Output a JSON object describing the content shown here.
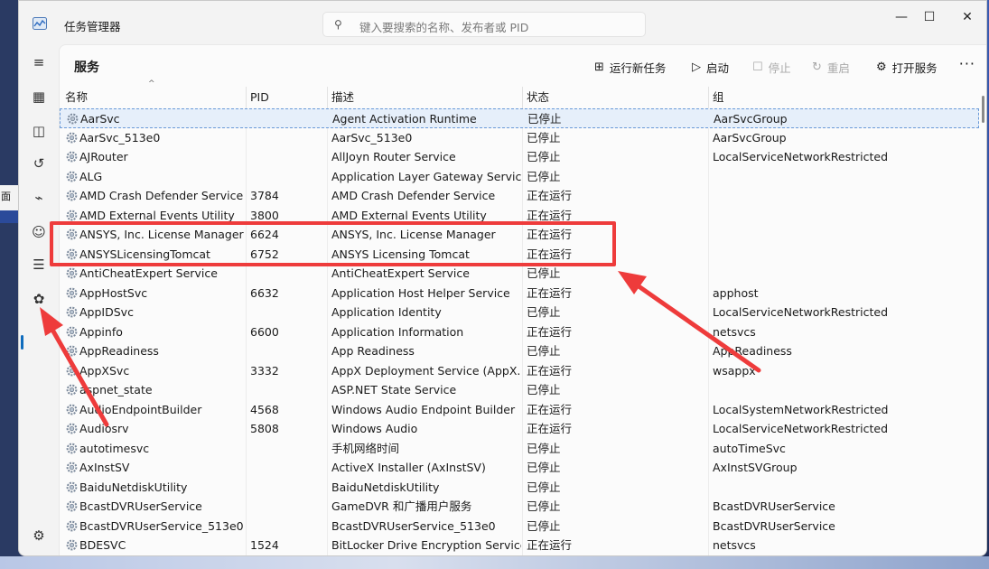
{
  "app": {
    "title": "任务管理器",
    "search_placeholder": "键入要搜索的名称、发布者或 PID",
    "minimize": "—",
    "maximize": "☐",
    "close": "✕"
  },
  "background": {
    "taskbar_fragment": "面"
  },
  "nav": {
    "items": [
      {
        "name": "menu-icon",
        "glyph": "≡"
      },
      {
        "name": "processes-icon",
        "glyph": "▦"
      },
      {
        "name": "performance-icon",
        "glyph": "◫"
      },
      {
        "name": "app-history-icon",
        "glyph": "↺"
      },
      {
        "name": "startup-icon",
        "glyph": "⌁"
      },
      {
        "name": "users-icon",
        "glyph": "☺"
      },
      {
        "name": "details-icon",
        "glyph": "☰"
      },
      {
        "name": "services-icon",
        "glyph": "✿"
      },
      {
        "name": "settings-icon",
        "glyph": "⚙"
      }
    ]
  },
  "page": {
    "title": "服务"
  },
  "toolbar": {
    "run_new_task": "运行新任务",
    "start": "启动",
    "stop": "停止",
    "restart": "重启",
    "open_services": "打开服务",
    "more": "···"
  },
  "table": {
    "columns": [
      "名称",
      "PID",
      "描述",
      "状态",
      "组"
    ],
    "rows": [
      [
        "AarSvc",
        "",
        "Agent Activation Runtime",
        "已停止",
        "AarSvcGroup"
      ],
      [
        "AarSvc_513e0",
        "",
        "AarSvc_513e0",
        "已停止",
        "AarSvcGroup"
      ],
      [
        "AJRouter",
        "",
        "AllJoyn Router Service",
        "已停止",
        "LocalServiceNetworkRestricted"
      ],
      [
        "ALG",
        "",
        "Application Layer Gateway Service",
        "已停止",
        ""
      ],
      [
        "AMD Crash Defender Service",
        "3784",
        "AMD Crash Defender Service",
        "正在运行",
        ""
      ],
      [
        "AMD External Events Utility",
        "3800",
        "AMD External Events Utility",
        "正在运行",
        ""
      ],
      [
        "ANSYS, Inc. License Manager",
        "6624",
        "ANSYS, Inc. License Manager",
        "正在运行",
        ""
      ],
      [
        "ANSYSLicensingTomcat",
        "6752",
        "ANSYS Licensing Tomcat",
        "正在运行",
        ""
      ],
      [
        "AntiCheatExpert Service",
        "",
        "AntiCheatExpert Service",
        "已停止",
        ""
      ],
      [
        "AppHostSvc",
        "6632",
        "Application Host Helper Service",
        "正在运行",
        "apphost"
      ],
      [
        "AppIDSvc",
        "",
        "Application Identity",
        "已停止",
        "LocalServiceNetworkRestricted"
      ],
      [
        "Appinfo",
        "6600",
        "Application Information",
        "正在运行",
        "netsvcs"
      ],
      [
        "AppReadiness",
        "",
        "App Readiness",
        "已停止",
        "AppReadiness"
      ],
      [
        "AppXSvc",
        "3332",
        "AppX Deployment Service (AppX...",
        "正在运行",
        "wsappx"
      ],
      [
        "aspnet_state",
        "",
        "ASP.NET State Service",
        "已停止",
        ""
      ],
      [
        "AudioEndpointBuilder",
        "4568",
        "Windows Audio Endpoint Builder",
        "正在运行",
        "LocalSystemNetworkRestricted"
      ],
      [
        "Audiosrv",
        "5808",
        "Windows Audio",
        "正在运行",
        "LocalServiceNetworkRestricted"
      ],
      [
        "autotimesvc",
        "",
        "手机网络时间",
        "已停止",
        "autoTimeSvc"
      ],
      [
        "AxInstSV",
        "",
        "ActiveX Installer (AxInstSV)",
        "已停止",
        "AxInstSVGroup"
      ],
      [
        "BaiduNetdiskUtility",
        "",
        "BaiduNetdiskUtility",
        "已停止",
        ""
      ],
      [
        "BcastDVRUserService",
        "",
        "GameDVR 和广播用户服务",
        "已停止",
        "BcastDVRUserService"
      ],
      [
        "BcastDVRUserService_513e0",
        "",
        "BcastDVRUserService_513e0",
        "已停止",
        "BcastDVRUserService"
      ],
      [
        "BDESVC",
        "1524",
        "BitLocker Drive Encryption Service",
        "正在运行",
        "netsvcs"
      ]
    ]
  },
  "colors": {
    "annotation": "#ee3b3b",
    "accent": "#0f6cbd",
    "selection": "#e6effa"
  }
}
